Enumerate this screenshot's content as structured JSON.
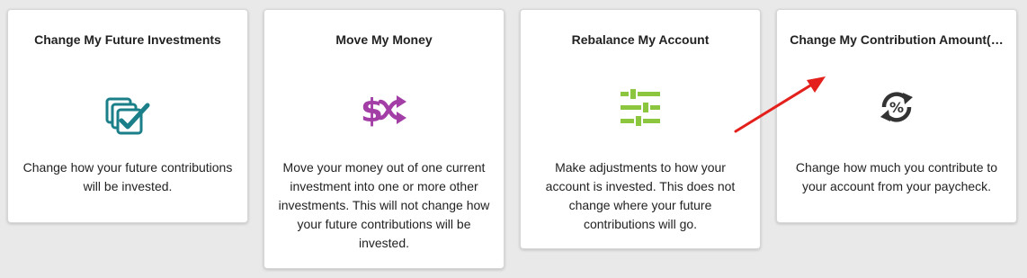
{
  "cards": [
    {
      "title": "Change My Future Investments",
      "icon": "checkbox-stack-icon",
      "icon_color": "#1a7f88",
      "description": "Change how your future contributions will be invested."
    },
    {
      "title": "Move My Money",
      "icon": "dollar-shuffle-icon",
      "icon_color": "#a23ea6",
      "description": "Move your money out of one current investment into one or more other investments. This will not change how your future contributions will be invested."
    },
    {
      "title": "Rebalance My Account",
      "icon": "sliders-icon",
      "icon_color": "#8cc63f",
      "description": "Make adjustments to how your account is invested. This does not change where your future contributions will go."
    },
    {
      "title": "Change My Contribution Amount(…",
      "icon": "percent-cycle-icon",
      "icon_color": "#333333",
      "description": "Change how much you contribute to your account from your paycheck."
    }
  ],
  "annotation": {
    "icon": "red-arrow-icon",
    "color": "#e3201b"
  }
}
